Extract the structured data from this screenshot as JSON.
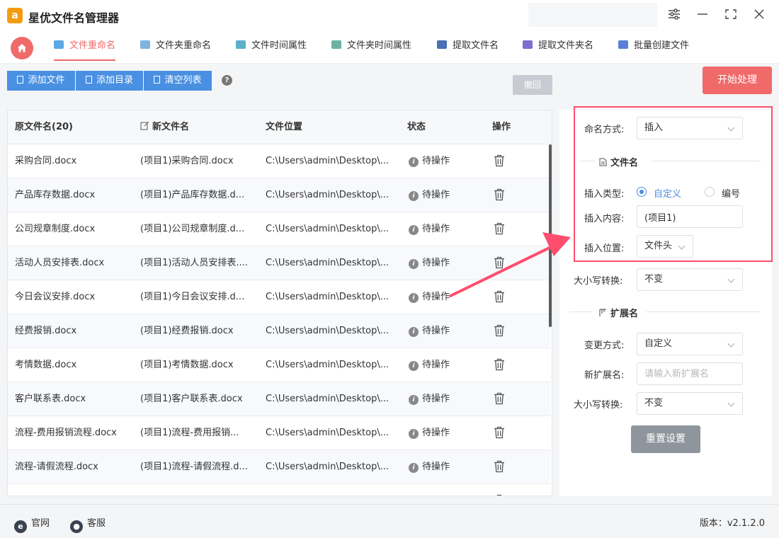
{
  "app": {
    "title": "星优文件名管理器",
    "logo_text": "a"
  },
  "window_controls": {
    "settings": "⚙",
    "minimize": "—",
    "maximize": "⛶",
    "close": "✕"
  },
  "nav": {
    "tabs": [
      {
        "label": "文件重命名",
        "active": true,
        "icon_color": "#5aa9e6"
      },
      {
        "label": "文件夹重命名",
        "active": false,
        "icon_color": "#7fb3e0"
      },
      {
        "label": "文件时间属性",
        "active": false,
        "icon_color": "#5ab0c9"
      },
      {
        "label": "文件夹时间属性",
        "active": false,
        "icon_color": "#6bb3a0"
      },
      {
        "label": "提取文件名",
        "active": false,
        "icon_color": "#4a6fb3"
      },
      {
        "label": "提取文件夹名",
        "active": false,
        "icon_color": "#7b6fd0"
      },
      {
        "label": "批量创建文件",
        "active": false,
        "icon_color": "#5a7fd6"
      }
    ]
  },
  "toolbar": {
    "add_file": "添加文件",
    "add_dir": "添加目录",
    "clear_list": "清空列表",
    "help": "?",
    "undo": "撤回",
    "start": "开始处理"
  },
  "table": {
    "headers": {
      "original": "原文件名(20)",
      "new_name": "新文件名",
      "location": "文件位置",
      "status": "状态",
      "action": "操作"
    },
    "rows": [
      {
        "original": "采购合同.docx",
        "new_name": "(项目1)采购合同.docx",
        "location": "C:\\Users\\admin\\Desktop\\...",
        "status": "待操作"
      },
      {
        "original": "产品库存数据.docx",
        "new_name": "(项目1)产品库存数据.d...",
        "location": "C:\\Users\\admin\\Desktop\\...",
        "status": "待操作"
      },
      {
        "original": "公司规章制度.docx",
        "new_name": "(项目1)公司规章制度.d...",
        "location": "C:\\Users\\admin\\Desktop\\...",
        "status": "待操作"
      },
      {
        "original": "活动人员安排表.docx",
        "new_name": "(项目1)活动人员安排表....",
        "location": "C:\\Users\\admin\\Desktop\\...",
        "status": "待操作"
      },
      {
        "original": "今日会议安排.docx",
        "new_name": "(项目1)今日会议安排.d...",
        "location": "C:\\Users\\admin\\Desktop\\...",
        "status": "待操作"
      },
      {
        "original": "经费报销.docx",
        "new_name": "(项目1)经费报销.docx",
        "location": "C:\\Users\\admin\\Desktop\\...",
        "status": "待操作"
      },
      {
        "original": "考情数据.docx",
        "new_name": "(项目1)考情数据.docx",
        "location": "C:\\Users\\admin\\Desktop\\...",
        "status": "待操作"
      },
      {
        "original": "客户联系表.docx",
        "new_name": "(项目1)客户联系表.docx",
        "location": "C:\\Users\\admin\\Desktop\\...",
        "status": "待操作"
      },
      {
        "original": "流程-费用报销流程.docx",
        "new_name": "(项目1)流程-费用报销...",
        "location": "C:\\Users\\admin\\Desktop\\...",
        "status": "待操作"
      },
      {
        "original": "流程-请假流程.docx",
        "new_name": "(项目1)流程-请假流程.d...",
        "location": "C:\\Users\\admin\\Desktop\\...",
        "status": "待操作"
      }
    ]
  },
  "settings": {
    "naming_mode_label": "命名方式:",
    "naming_mode_value": "插入",
    "filename_section": "文件名",
    "insert_type_label": "插入类型:",
    "insert_type_custom": "自定义",
    "insert_type_number": "编号",
    "insert_content_label": "插入内容:",
    "insert_content_value": "(项目1)",
    "insert_position_label": "插入位置:",
    "insert_position_value": "文件头",
    "case_label": "大小写转换:",
    "case_value": "不变",
    "ext_section": "扩展名",
    "change_mode_label": "变更方式:",
    "change_mode_value": "自定义",
    "new_ext_label": "新扩展名:",
    "new_ext_placeholder": "请输入新扩展名",
    "ext_case_label": "大小写转换:",
    "ext_case_value": "不变",
    "reset": "重置设置"
  },
  "footer": {
    "website": "官网",
    "service": "客服",
    "version": "版本：v2.1.2.0"
  },
  "colors": {
    "accent": "#f06a6a",
    "primary": "#4a90e2",
    "highlight": "#ff4d6d"
  }
}
